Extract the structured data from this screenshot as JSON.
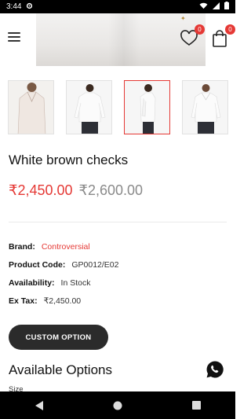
{
  "status_bar": {
    "time": "3:44",
    "icons": [
      "settings-icon",
      "wifi-icon",
      "signal-icon",
      "battery-icon"
    ]
  },
  "header": {
    "menu_icon": "hamburger-icon",
    "wishlist_icon": "heart-icon",
    "wishlist_count": "0",
    "cart_icon": "shopping-bag-icon",
    "cart_count": "0"
  },
  "thumbnails": [
    {
      "name": "front-closeup",
      "active": false
    },
    {
      "name": "back-view",
      "active": false
    },
    {
      "name": "side-view",
      "active": true
    },
    {
      "name": "front-view",
      "active": false
    }
  ],
  "product": {
    "title": "White brown checks",
    "price": "₹2,450.00",
    "old_price": "₹2,600.00",
    "details": {
      "brand_label": "Brand:",
      "brand_value": "Controversial",
      "code_label": "Product Code:",
      "code_value": "GP0012/E02",
      "availability_label": "Availability:",
      "availability_value": "In Stock",
      "tax_label": "Ex Tax:",
      "tax_value": "₹2,450.00"
    }
  },
  "actions": {
    "custom_option_label": "CUSTOM OPTION"
  },
  "options": {
    "heading": "Available Options",
    "size_label": "Size"
  },
  "colors": {
    "accent": "#e53935",
    "button_bg": "#2b2b2b",
    "whatsapp": "#111111"
  }
}
